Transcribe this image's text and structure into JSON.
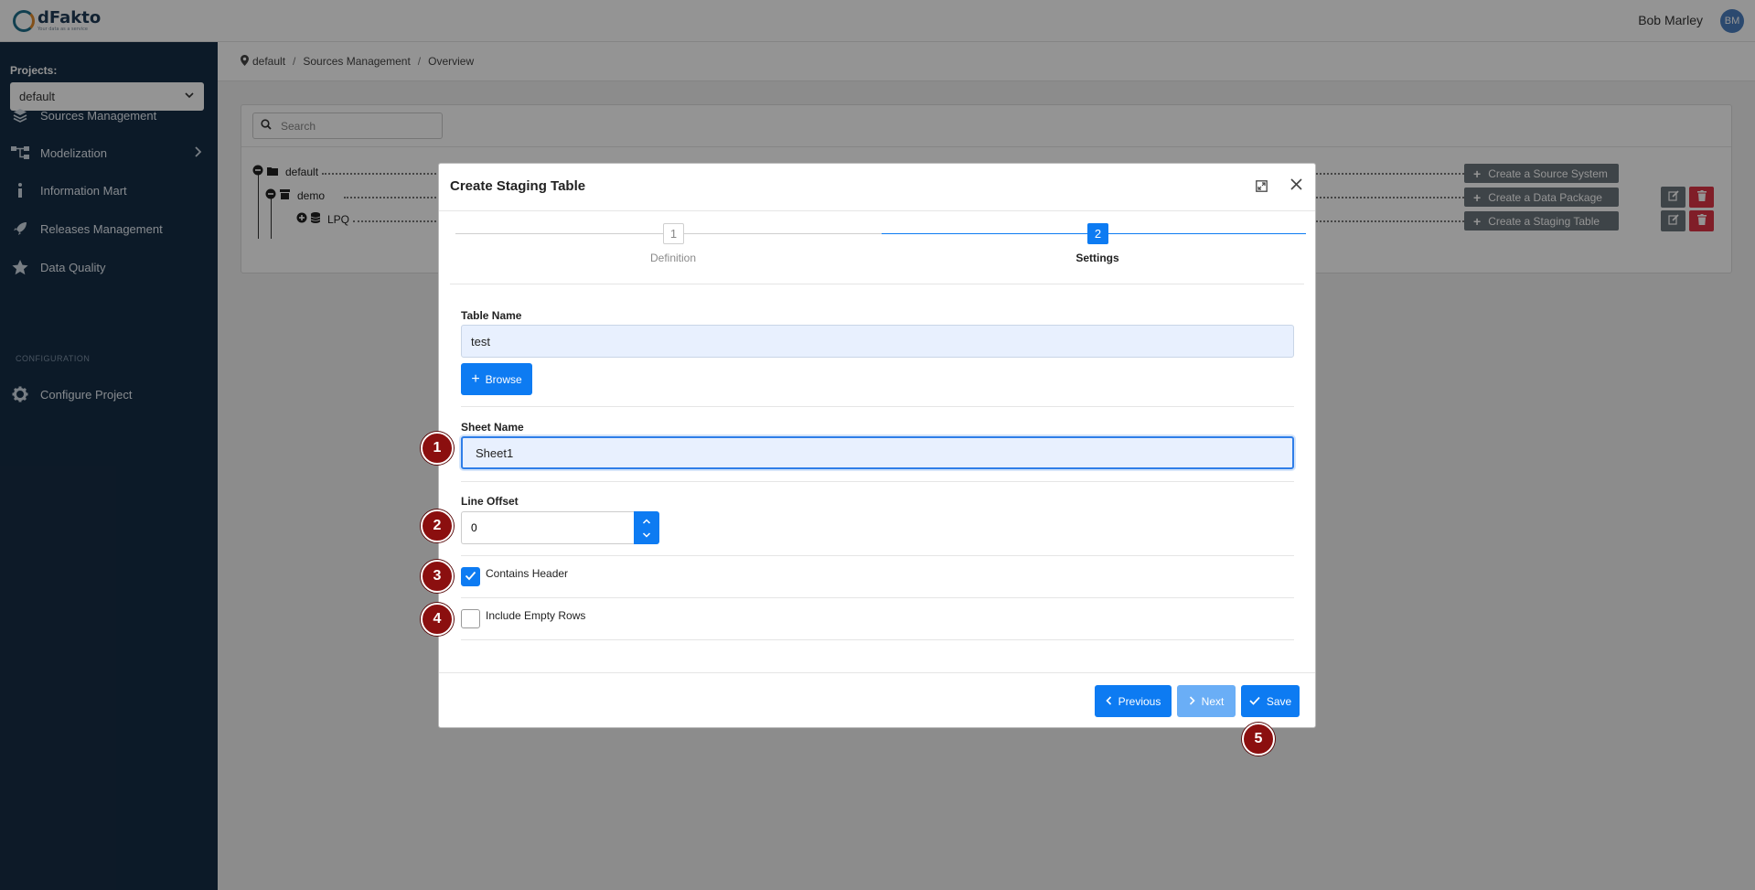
{
  "app": {
    "brand": "dFakto",
    "brand_tagline": "Your data as a service",
    "user_name": "Bob Marley",
    "user_initials": "BM"
  },
  "sidebar": {
    "projects_label": "Projects:",
    "project_selected": "default",
    "items": [
      {
        "label": "Sources Management",
        "icon": "layers-icon"
      },
      {
        "label": "Modelization",
        "icon": "sitemap-icon"
      },
      {
        "label": "Information Mart",
        "icon": "info-icon"
      },
      {
        "label": "Releases Management",
        "icon": "rocket-icon"
      },
      {
        "label": "Data Quality",
        "icon": "star-icon"
      }
    ],
    "configuration_label": "CONFIGURATION",
    "configure_project_label": "Configure Project"
  },
  "breadcrumb": {
    "items": [
      "default",
      "Sources Management",
      "Overview"
    ]
  },
  "main": {
    "search_placeholder": "Search",
    "tree": [
      {
        "label": "default",
        "action": "Create a Source System"
      },
      {
        "label": "demo",
        "action": "Create a Data Package"
      },
      {
        "label": "LPQ",
        "action": "Create a Staging Table"
      }
    ]
  },
  "modal": {
    "title": "Create Staging Table",
    "steps": [
      {
        "number": "1",
        "label": "Definition"
      },
      {
        "number": "2",
        "label": "Settings"
      }
    ],
    "table_name_label": "Table Name",
    "table_name_value": "test",
    "browse_label": "Browse",
    "sheet_name_label": "Sheet Name",
    "sheet_name_value": "Sheet1",
    "line_offset_label": "Line Offset",
    "line_offset_value": "0",
    "contains_header_label": "Contains Header",
    "contains_header_checked": true,
    "include_empty_rows_label": "Include Empty Rows",
    "include_empty_rows_checked": false,
    "previous_label": "Previous",
    "next_label": "Next",
    "save_label": "Save"
  },
  "markers": [
    "1",
    "2",
    "3",
    "4",
    "5"
  ],
  "colors": {
    "sidebar_bg": "#162d45",
    "primary": "#0d7bf2",
    "primary_disabled": "#6aaef6",
    "secondary": "#6c757d",
    "danger": "#dc3545",
    "marker": "#8b0f0f"
  }
}
